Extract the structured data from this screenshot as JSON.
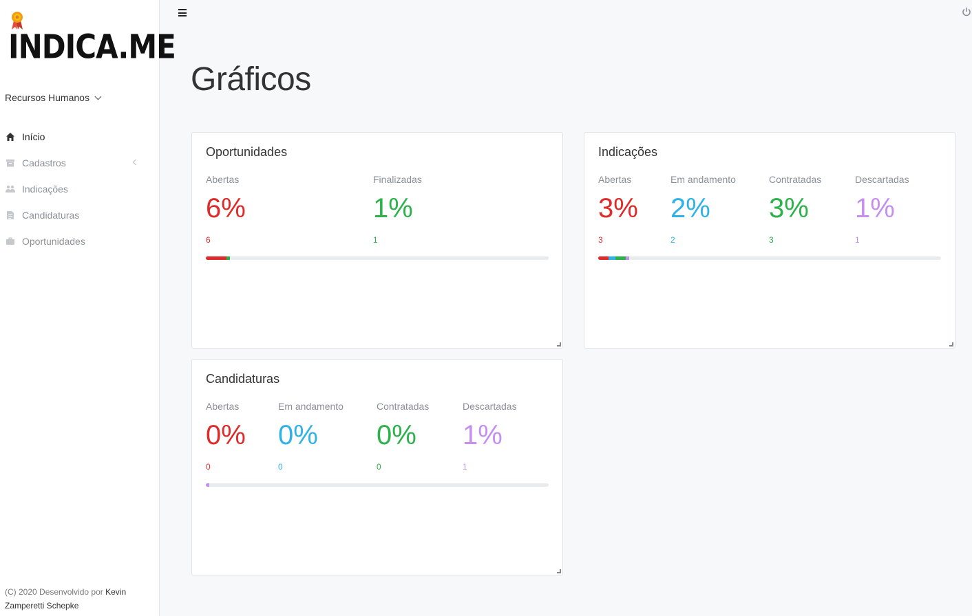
{
  "brand": {
    "logo_text": "INDICA.ME"
  },
  "role_selector": {
    "label": "Recursos Humanos"
  },
  "sidebar": {
    "items": [
      {
        "label": "Início",
        "icon": "home-icon",
        "active": true
      },
      {
        "label": "Cadastros",
        "icon": "archive-icon",
        "active": false
      },
      {
        "label": "Indicações",
        "icon": "users-icon",
        "active": false
      },
      {
        "label": "Candidaturas",
        "icon": "file-icon",
        "active": false
      },
      {
        "label": "Oportunidades",
        "icon": "briefcase-icon",
        "active": false
      }
    ]
  },
  "footer": {
    "text": "(C) 2020 Desenvolvido por",
    "author": "Kevin Zamperetti Schepke"
  },
  "page": {
    "title": "Gráficos"
  },
  "colors": {
    "red": "#e02a2a",
    "blue": "#2fb2ea",
    "green": "#2bb24a",
    "purple": "#c48ff0",
    "track": "#e9ecef"
  },
  "cards": {
    "oportunidades": {
      "title": "Oportunidades",
      "stats": [
        {
          "label": "Abertas",
          "percent": "6%",
          "count": "6",
          "color": "red"
        },
        {
          "label": "Finalizadas",
          "percent": "1%",
          "count": "1",
          "color": "green"
        }
      ]
    },
    "indicacoes": {
      "title": "Indicações",
      "stats": [
        {
          "label": "Abertas",
          "percent": "3%",
          "count": "3",
          "color": "red"
        },
        {
          "label": "Em andamento",
          "percent": "2%",
          "count": "2",
          "color": "blue"
        },
        {
          "label": "Contratadas",
          "percent": "3%",
          "count": "3",
          "color": "green"
        },
        {
          "label": "Descartadas",
          "percent": "1%",
          "count": "1",
          "color": "purple"
        }
      ]
    },
    "candidaturas": {
      "title": "Candidaturas",
      "stats": [
        {
          "label": "Abertas",
          "percent": "0%",
          "count": "0",
          "color": "red"
        },
        {
          "label": "Em andamento",
          "percent": "0%",
          "count": "0",
          "color": "blue"
        },
        {
          "label": "Contratadas",
          "percent": "0%",
          "count": "0",
          "color": "green"
        },
        {
          "label": "Descartadas",
          "percent": "1%",
          "count": "1",
          "color": "purple"
        }
      ]
    }
  }
}
